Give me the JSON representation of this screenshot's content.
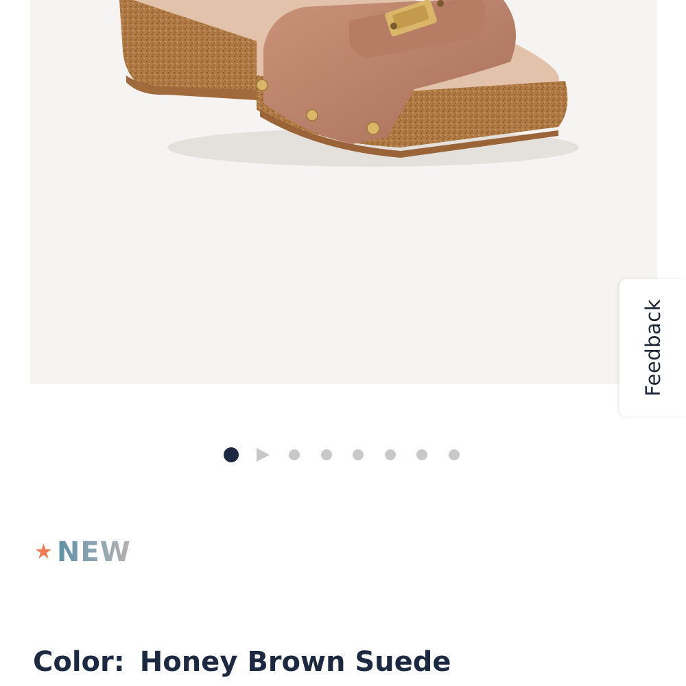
{
  "feedback": {
    "label": "Feedback"
  },
  "gallery": {
    "product_image": "honey-brown-suede-clog-sandal",
    "background_color": "#f5f4f2",
    "slide_count": 8,
    "active_slide": 1,
    "slides": [
      {
        "type": "image",
        "active": true
      },
      {
        "type": "video"
      },
      {
        "type": "image"
      },
      {
        "type": "image"
      },
      {
        "type": "image"
      },
      {
        "type": "image"
      },
      {
        "type": "image"
      },
      {
        "type": "image"
      }
    ]
  },
  "badge": {
    "icon": "star-icon",
    "label": "NEW",
    "star_color": "#f07a52"
  },
  "product": {
    "color_label": "Color:",
    "color_value": "Honey Brown Suede",
    "text_color": "#1c2940"
  }
}
